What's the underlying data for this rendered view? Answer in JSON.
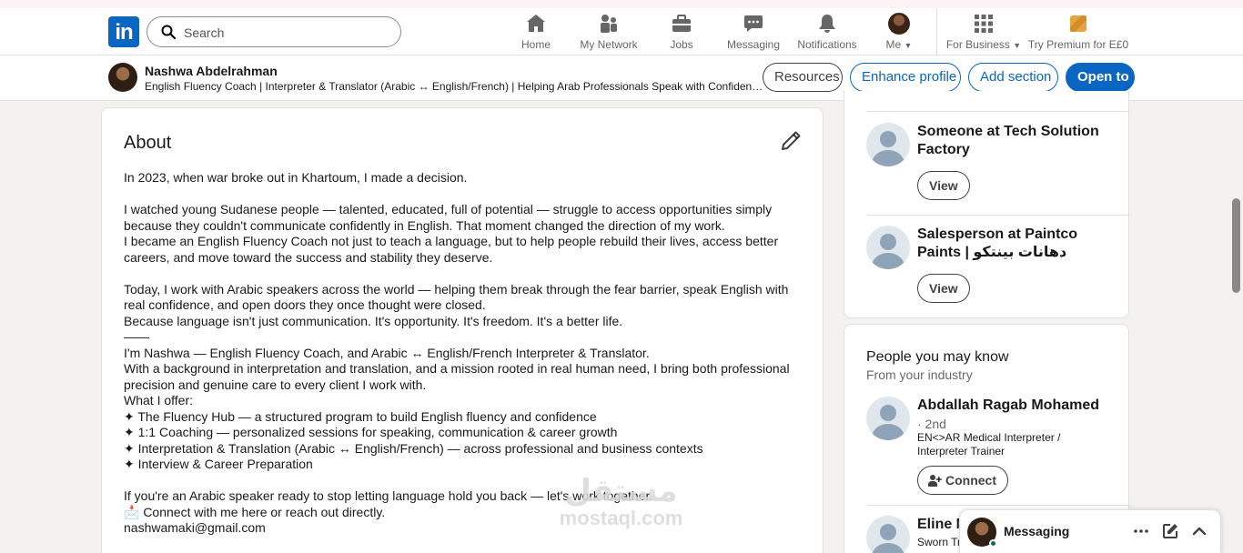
{
  "nav": {
    "logo_text": "in",
    "search_placeholder": "Search",
    "items": [
      {
        "label": "Home",
        "icon": "home-icon"
      },
      {
        "label": "My Network",
        "icon": "people-icon"
      },
      {
        "label": "Jobs",
        "icon": "briefcase-icon"
      },
      {
        "label": "Messaging",
        "icon": "chat-icon"
      },
      {
        "label": "Notifications",
        "icon": "bell-icon"
      },
      {
        "label": "Me",
        "icon": "avatar"
      },
      {
        "label": "For Business",
        "icon": "grid-icon"
      },
      {
        "label": "Try Premium for E£0",
        "icon": "premium-icon"
      }
    ]
  },
  "profile_bar": {
    "name": "Nashwa Abdelrahman",
    "headline": "English Fluency Coach | Interpreter & Translator (Arabic ↔ English/French) | Helping Arab Professionals Speak with Confidence ...",
    "buttons": {
      "resources": "Resources",
      "enhance": "Enhance profile",
      "add_section": "Add section",
      "open_to": "Open to"
    }
  },
  "about": {
    "title": "About",
    "paragraphs": [
      "In 2023, when war broke out in Khartoum, I made a decision.",
      "I watched young Sudanese people — talented, educated, full of potential — struggle to access opportunities simply because they couldn't communicate confidently in English. That moment changed the direction of my work.\nI became an English Fluency Coach not just to teach a language, but to help people rebuild their lives, access better careers, and move toward the success and stability they deserve.",
      "Today, I work with Arabic speakers across the world — helping them break through the fear barrier, speak English with real confidence, and open doors they once thought were closed.\nBecause language isn't just communication. It's opportunity. It's freedom. It's a better life.\n——\nI'm Nashwa — English Fluency Coach, and Arabic ↔ English/French Interpreter & Translator.\nWith a background in interpretation and translation, and a mission rooted in real human need, I bring both professional precision and genuine care to every client I work with.\nWhat I offer:\n✦ The Fluency Hub — a structured program to build English fluency and confidence\n✦ 1:1 Coaching — personalized sessions for speaking, communication & career growth\n✦ Interpretation & Translation (Arabic ↔ English/French) — across professional and business contexts\n✦ Interview & Career Preparation",
      "If you're an Arabic speaker ready to stop letting language hold you back — let's work together.\n📩 Connect with me here or reach out directly.\nnashwamaki@gmail.com"
    ]
  },
  "viewers": [
    {
      "name": "Someone at Tech Solution Factory",
      "button": "View"
    },
    {
      "name": "Salesperson at Paintco Paints | دهانات بينتكو",
      "button": "View"
    }
  ],
  "pymk": {
    "title": "People you may know",
    "subtitle": "From your industry",
    "people": [
      {
        "name": "Abdallah Ragab Mohamed",
        "degree": "· 2nd",
        "headline": "EN<>AR Medical Interpreter / Interpreter Trainer",
        "button": "Connect"
      },
      {
        "name": "Eline N",
        "headline": "Sworn Tr"
      }
    ]
  },
  "messaging": {
    "title": "Messaging"
  },
  "watermark": {
    "arabic": "مستقل",
    "latin": "mostaql.com"
  },
  "colors": {
    "brand": "#0a66c2",
    "background": "#f4f2ee",
    "online": "#01754f"
  }
}
